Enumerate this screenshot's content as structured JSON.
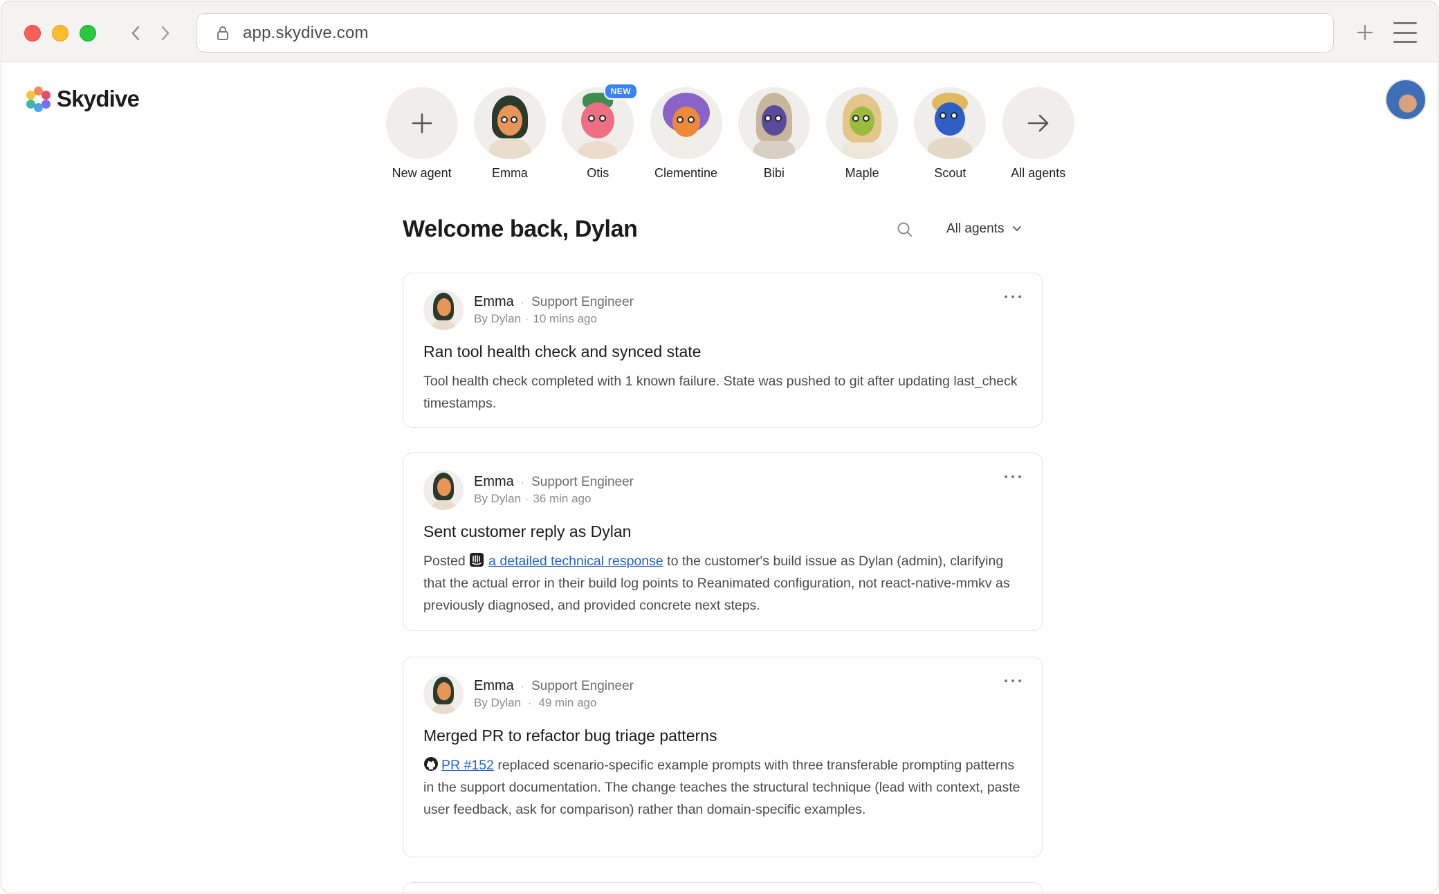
{
  "browser": {
    "url": "app.skydive.com"
  },
  "app": {
    "brand": "Skydive",
    "logo_colors": [
      "#f08a5d",
      "#e94b6f",
      "#3fb6a8",
      "#f5c33b",
      "#7b6cf6",
      "#4aa3ea"
    ]
  },
  "agents": [
    {
      "label": "New agent",
      "icon": "plus-icon"
    },
    {
      "label": "Emma",
      "icon": "emma-avatar"
    },
    {
      "label": "Otis",
      "icon": "otis-avatar",
      "badge": "NEW"
    },
    {
      "label": "Clementine",
      "icon": "clementine-avatar"
    },
    {
      "label": "Bibi",
      "icon": "bibi-avatar"
    },
    {
      "label": "Maple",
      "icon": "maple-avatar"
    },
    {
      "label": "Scout",
      "icon": "scout-avatar"
    },
    {
      "label": "All agents",
      "icon": "arrow-right-icon"
    }
  ],
  "feed": {
    "welcome": "Welcome back, Dylan",
    "filter_label": "All agents",
    "cards": [
      {
        "agent": "Emma",
        "role": "Support Engineer",
        "by": "By Dylan",
        "time": "10 mins ago",
        "title": "Ran tool health check and synced state",
        "body": "Tool health check completed with 1 known failure. State was pushed to git after updating last_check timestamps."
      },
      {
        "agent": "Emma",
        "role": "Support Engineer",
        "by": "By Dylan",
        "time": "36 min ago",
        "title": "Sent customer reply as Dylan",
        "body_prefix": "Posted",
        "link": "a detailed technical response",
        "body_suffix": "to the customer's build issue as Dylan (admin), clarifying that the actual error in their build log points to Reanimated configuration, not react-native-mmkv as previously diagnosed, and provided concrete next steps."
      },
      {
        "agent": "Emma",
        "role": "Support Engineer",
        "by": "By Dylan",
        "time": "49 min ago",
        "title": "Merged PR to refactor bug triage patterns",
        "link": "PR #152",
        "body_suffix": "replaced scenario-specific example prompts with three transferable prompting patterns in the support documentation. The change teaches the structural technique (lead with context, paste user feedback, ask for comparison) rather than domain-specific examples."
      }
    ]
  },
  "colors": {
    "link": "#2563c9",
    "badge": "#3b82f6",
    "card_border": "#e3e2df"
  }
}
